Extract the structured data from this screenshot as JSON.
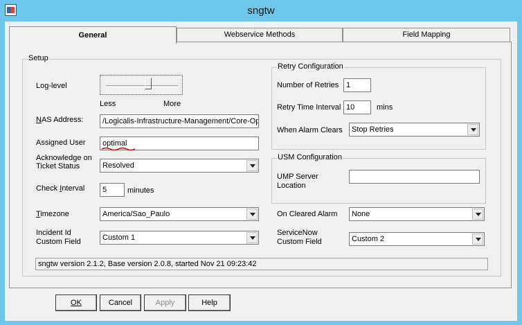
{
  "window": {
    "title": "sngtw"
  },
  "tabs": [
    "General",
    "Webservice Methods",
    "Field Mapping"
  ],
  "setup": {
    "group_label": "Setup",
    "log_level_label": "Log-level",
    "slider_less": "Less",
    "slider_more": "More",
    "log_level_fraction": 0.6,
    "nas_address_label": "NAS Address:",
    "nas_address_value": "/Logicalis-Infrastructure-Management/Core-Opti",
    "assigned_user_label": "Assigned User",
    "assigned_user_value": "optimal",
    "ack_label_line1": "Acknowledge on",
    "ack_label_line2": "Ticket Status",
    "ack_value": "Resolved",
    "check_interval_label": "Check Interval",
    "check_interval_value": "5",
    "check_interval_unit": "minutes",
    "timezone_label": "Timezone",
    "timezone_value": "America/Sao_Paulo",
    "incident_label_line1": "Incident Id",
    "incident_label_line2": "Custom Field",
    "incident_value": "Custom 1"
  },
  "retry": {
    "group_label": "Retry Configuration",
    "retries_label": "Number of Retries",
    "retries_value": "1",
    "interval_label": "Retry Time Interval",
    "interval_value": "10",
    "interval_unit": "mins",
    "alarm_clears_label": "When Alarm Clears",
    "alarm_clears_value": "Stop Retries"
  },
  "usm": {
    "group_label": "USM Configuration",
    "ump_label_line1": "UMP Server",
    "ump_label_line2": "Location",
    "ump_value": ""
  },
  "on_cleared": {
    "label": "On Cleared Alarm",
    "value": "None"
  },
  "servicenow": {
    "label_line1": "ServiceNow",
    "label_line2": "Custom Field",
    "value": "Custom 2"
  },
  "status_text": "sngtw version 2.1.2, Base version 2.0.8, started Nov 21 09:23:42",
  "buttons": {
    "ok": "OK",
    "cancel": "Cancel",
    "apply": "Apply",
    "help": "Help"
  },
  "colors": {
    "title_bar": "#6ec6ea",
    "dialog_bg": "#f0f0f0",
    "spell_underline": "#d00000"
  }
}
